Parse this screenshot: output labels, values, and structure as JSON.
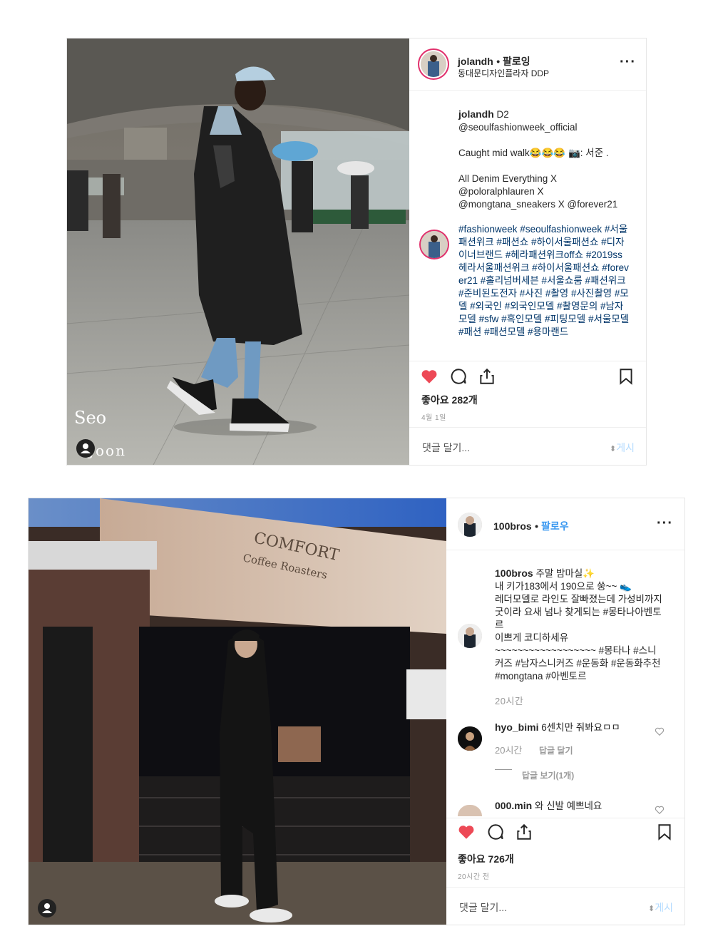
{
  "post1": {
    "username": "jolandh",
    "follow_state": "• 팔로잉",
    "location": "동대문디자인플라자 DDP",
    "caption_user": "jolandh",
    "caption_lines": [
      "D2",
      "@seoulfashionweek_official",
      "",
      "Caught mid walk😂😂😂 📷: 서준 .",
      "",
      "All Denim Everything X",
      "@poloralphlauren X",
      "@mongtana_sneakers X @forever21"
    ],
    "hashtags": "#fashionweek #seoulfashionweek #서울패션위크 #패션쇼 #하이서울패션쇼 #디자이너브랜드 #헤라패션위크off쇼 #2019ss헤라서울패션위크 #하이서울패션쇼 #forever21 #홀리넘버세븐 #서울쇼룸 #패션위크 #준비된도전자 #사진 #촬영 #사진촬영 #모델 #외국인 #외국인모델 #촬영문의 #남자모델 #sfw #흑인모델 #피팅모델 #서울모델 #패션 #패션모델 #용마랜드",
    "likes": "좋아요 282개",
    "date": "4월 1일",
    "comment_placeholder": "댓글 달기...",
    "post_label": "게시",
    "watermark_line1": "Seo",
    "watermark_line2": "Joon"
  },
  "post2": {
    "username": "100bros",
    "follow_state": "팔로우",
    "caption_user": "100bros",
    "caption_text": "주말 밤마실✨\n내 키가183에서 190으로 쑹~~ 👟\n레더모델로 라인도 잘빠졌는데 가성비까지 굿이라 요새 넘나 찾게되는 #몽타나아벤토르\n이쁘게 코디하세유\n~~~~~~~~~~~~~~~~~~ #몽타나 #스니커즈 #남자스니커즈 #운동화 #운동화추천 #mongtana #아벤토르",
    "caption_time": "20시간",
    "comments": [
      {
        "user": "hyo_bimi",
        "text": "6센치만 줘봐요ㅁㅁ",
        "time": "20시간",
        "reply": "답글 달기",
        "view_replies": "답글 보기(1개)"
      },
      {
        "user": "000.min",
        "text": "와 신발 예쁘네요"
      }
    ],
    "likes": "좋아요 726개",
    "date": "20시간 전",
    "comment_placeholder": "댓글 달기...",
    "post_label": "게시",
    "sign_text": "COMFORT",
    "sign_sub": "Coffee Roasters"
  },
  "colors": {
    "heart": "#ed4956",
    "link": "#3897f0",
    "hashtag": "#003569",
    "post_disabled": "#b3dbff"
  }
}
